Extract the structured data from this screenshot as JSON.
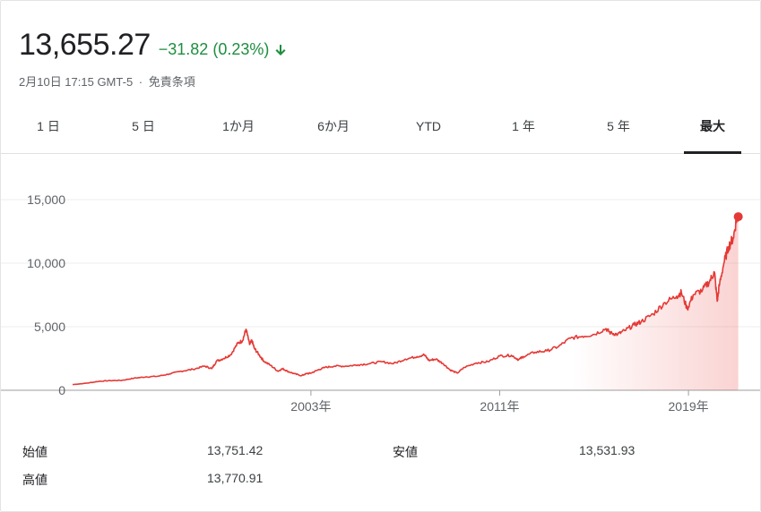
{
  "quote": {
    "price": "13,655.27",
    "change": "−31.82 (0.23%)",
    "direction_icon": "arrow-down-icon",
    "timestamp": "2月10日 17:15 GMT-5",
    "separator": "·",
    "disclaimer": "免責条項"
  },
  "tabs": [
    {
      "label": "1 日",
      "active": false
    },
    {
      "label": "5 日",
      "active": false
    },
    {
      "label": "1か月",
      "active": false
    },
    {
      "label": "6か月",
      "active": false
    },
    {
      "label": "YTD",
      "active": false
    },
    {
      "label": "1 年",
      "active": false
    },
    {
      "label": "5 年",
      "active": false
    },
    {
      "label": "最大",
      "active": true
    }
  ],
  "stats": {
    "open_label": "始値",
    "open_value": "13,751.42",
    "high_label": "高値",
    "high_value": "13,770.91",
    "low_label": "安値",
    "low_value": "13,531.93"
  },
  "colors": {
    "line": "#e53935",
    "fill": "#e53935",
    "positive": "#1e8e3e",
    "grid": "#eeeeee",
    "axis_text": "#5f6368"
  },
  "chart_data": {
    "type": "area",
    "ylim": [
      0,
      15000
    ],
    "yticks": [
      0,
      5000,
      10000,
      15000
    ],
    "ytick_labels": [
      "0",
      "5,000",
      "10,000",
      "15,000"
    ],
    "xlim": [
      1992.9,
      2021.2
    ],
    "xticks": [
      2003,
      2011,
      2019
    ],
    "xtick_labels": [
      "2003年",
      "2011年",
      "2019年"
    ],
    "grid": true,
    "series": [
      {
        "x": [
          1992.9,
          1993.5,
          1994.0,
          1994.5,
          1995.0,
          1995.5,
          1996.0,
          1996.5,
          1997.0,
          1997.5,
          1998.0,
          1998.5,
          1998.8,
          1999.0,
          1999.3,
          1999.6,
          1999.9,
          2000.1,
          2000.25,
          2000.4,
          2000.5,
          2000.6,
          2000.8,
          2001.0,
          2001.3,
          2001.6,
          2001.8,
          2002.0,
          2002.3,
          2002.6,
          2002.8,
          2003.0,
          2003.3,
          2003.6,
          2004.0,
          2004.5,
          2005.0,
          2005.5,
          2006.0,
          2006.5,
          2007.0,
          2007.5,
          2007.8,
          2008.0,
          2008.3,
          2008.6,
          2008.9,
          2009.2,
          2009.5,
          2010.0,
          2010.5,
          2011.0,
          2011.5,
          2011.8,
          2012.0,
          2012.5,
          2013.0,
          2013.5,
          2014.0,
          2014.5,
          2015.0,
          2015.5,
          2015.7,
          2016.0,
          2016.3,
          2016.7,
          2017.0,
          2017.5,
          2018.0,
          2018.5,
          2018.7,
          2018.95,
          2019.2,
          2019.6,
          2019.9,
          2020.1,
          2020.22,
          2020.3,
          2020.5,
          2020.7,
          2020.9,
          2021.05,
          2021.11
        ],
        "values": [
          450,
          560,
          700,
          760,
          780,
          950,
          1050,
          1100,
          1280,
          1500,
          1650,
          1900,
          1700,
          2300,
          2500,
          2800,
          3700,
          3900,
          4800,
          3600,
          3900,
          3300,
          2800,
          2300,
          1950,
          1500,
          1700,
          1500,
          1300,
          1150,
          1300,
          1350,
          1600,
          1800,
          1900,
          1900,
          2000,
          2100,
          2250,
          2100,
          2450,
          2650,
          2800,
          2350,
          2450,
          2100,
          1600,
          1350,
          1800,
          2150,
          2250,
          2700,
          2750,
          2400,
          2650,
          3000,
          3100,
          3450,
          4100,
          4250,
          4400,
          4850,
          4500,
          4400,
          4700,
          5150,
          5400,
          6000,
          6900,
          7400,
          7700,
          6400,
          7500,
          7900,
          8600,
          9300,
          7000,
          8200,
          10000,
          11300,
          12000,
          13600,
          13655.27
        ]
      }
    ],
    "last_point": {
      "x": 2021.11,
      "y": 13655.27
    }
  }
}
